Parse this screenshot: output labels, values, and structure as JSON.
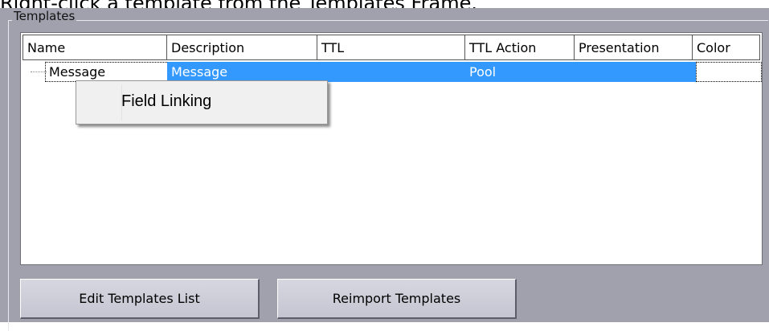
{
  "caption": "Right-click a template from the Templates Frame.",
  "groupbox": {
    "title": "Templates"
  },
  "columns": [
    "Name",
    "Description",
    "TTL",
    "TTL Action",
    "Presentation",
    "Color"
  ],
  "rows": [
    {
      "name": "Message",
      "description": "Message",
      "ttl": "",
      "ttl_action": "Pool",
      "presentation": "",
      "color": ""
    }
  ],
  "context_menu": {
    "items": [
      "Field Linking"
    ]
  },
  "buttons": {
    "edit": "Edit Templates List",
    "reimport": "Reimport Templates"
  },
  "colors": {
    "selection": "#3399ff",
    "panel": "#a1a0ad"
  }
}
